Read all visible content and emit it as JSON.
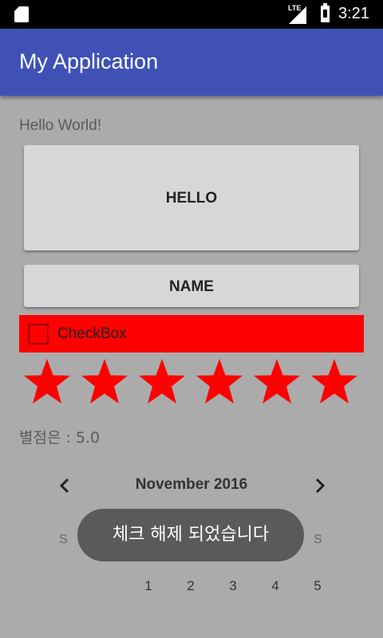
{
  "status_bar": {
    "time": "3:21",
    "network": "LTE"
  },
  "app_bar": {
    "title": "My Application",
    "color": "#3f51b5"
  },
  "main": {
    "hello_text": "Hello World!",
    "hello_button": "HELLO",
    "name_button": "NAME",
    "checkbox": {
      "label": "CheckBox",
      "checked": false,
      "bg_color": "#ff0000"
    },
    "rating": {
      "stars_total": 6,
      "stars_value": 6,
      "label": "별점은 : 5.0",
      "color": "#ff0000"
    }
  },
  "calendar": {
    "month": "November 2016",
    "day_of_week_visible": [
      "S",
      "S"
    ],
    "visible_days": [
      "1",
      "2",
      "3",
      "4",
      "5"
    ]
  },
  "toast": {
    "message": "체크 해제 되었습니다"
  }
}
